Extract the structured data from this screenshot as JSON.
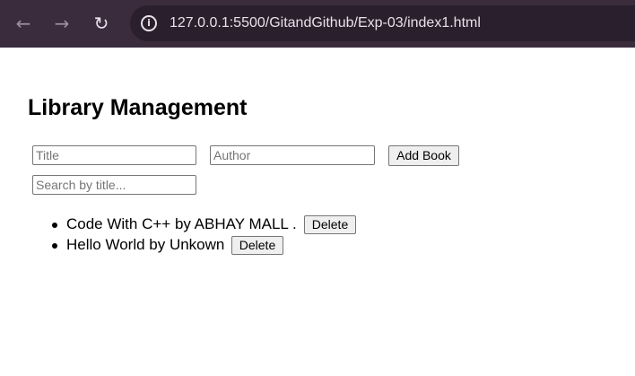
{
  "browser": {
    "back_icon": "arrow-left-icon",
    "forward_icon": "arrow-right-icon",
    "reload_icon": "reload-icon",
    "site_info_icon": "info-icon",
    "url": "127.0.0.1:5500/GitandGithub/Exp-03/index1.html",
    "colors": {
      "toolbar": "#3a2c3d",
      "url_field": "#2a1f2c",
      "text": "#e8e0ea"
    }
  },
  "page": {
    "heading": "Library Management",
    "title_placeholder": "Title",
    "author_placeholder": "Author",
    "add_button_label": "Add Book",
    "search_placeholder": "Search by title...",
    "books": [
      {
        "text": "Code With C++ by ABHAY MALL .",
        "delete_label": "Delete"
      },
      {
        "text": "Hello World by Unkown",
        "delete_label": "Delete"
      }
    ]
  }
}
